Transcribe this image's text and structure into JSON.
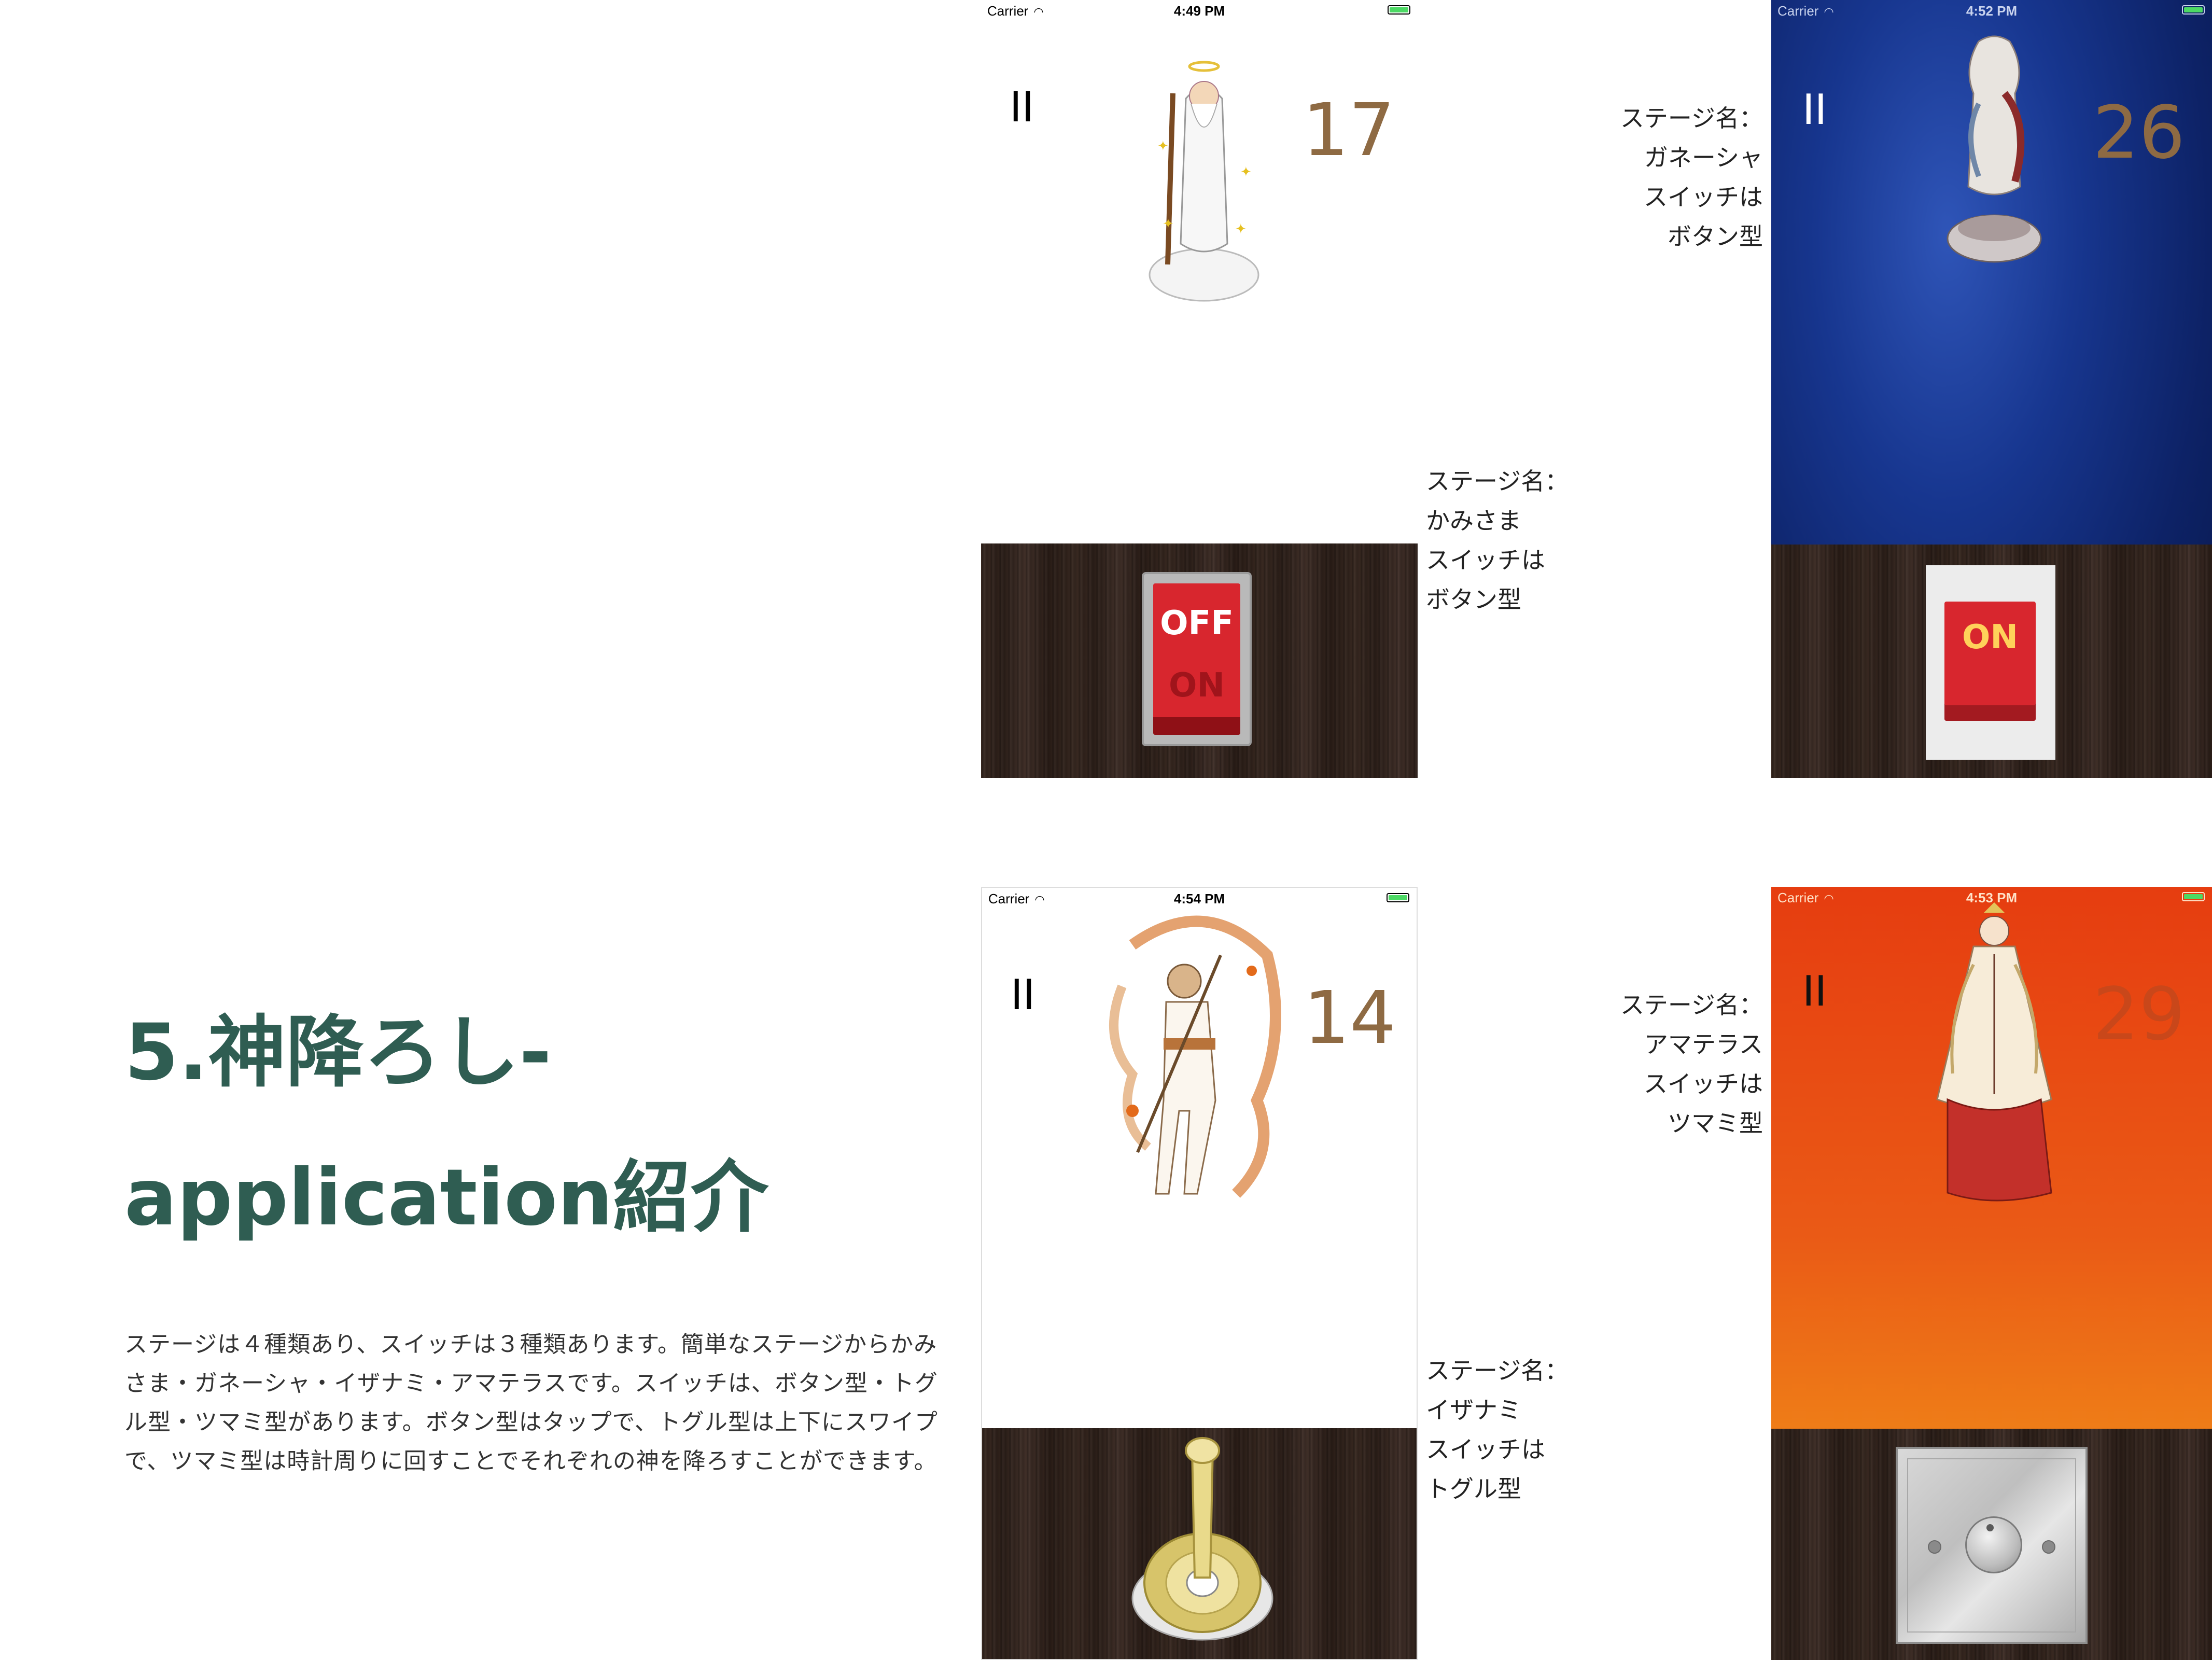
{
  "title": {
    "line1": "5.神降ろし-",
    "line2": "application紹介"
  },
  "description": "ステージは４種類あり、スイッチは３種類あります。簡単なステージからかみさま・ガネーシャ・イザナミ・アマテラスです。スイッチは、ボタン型・トグル型・ツマミ型があります。ボタン型はタップで、トグル型は上下にスワイプで、ツマミ型は時計周りに回すことでそれぞれの神を降ろすことができます。",
  "screens": {
    "kamisama": {
      "carrier": "Carrier",
      "time": "4:49 PM",
      "score": "17",
      "pause": "II",
      "switch_top": "OFF",
      "switch_bottom": "ON",
      "caption": [
        "ステージ名：",
        "かみさま",
        "スイッチは",
        "ボタン型"
      ]
    },
    "ganesha": {
      "carrier": "Carrier",
      "time": "4:52 PM",
      "score": "26",
      "pause": "II",
      "switch_label": "ON",
      "caption": [
        "ステージ名：",
        "ガネーシャ",
        "スイッチは",
        "ボタン型"
      ]
    },
    "izanami": {
      "carrier": "Carrier",
      "time": "4:54 PM",
      "score": "14",
      "pause": "II",
      "caption": [
        "ステージ名：",
        "イザナミ",
        "スイッチは",
        "トグル型"
      ]
    },
    "amaterasu": {
      "carrier": "Carrier",
      "time": "4:53 PM",
      "score": "29",
      "pause": "II",
      "caption": [
        "ステージ名：",
        "アマテラス",
        "スイッチは",
        "ツマミ型"
      ]
    }
  },
  "colors": {
    "title": "#2f5d52",
    "score": "#8e6a43",
    "space_bg": "#0f2a72",
    "sun_bg": "#e84a14",
    "switch_red": "#d8262e"
  },
  "icons": [
    "wifi-icon",
    "battery-icon",
    "pause-icon",
    "toggle-switch-icon",
    "dial-knob-icon"
  ]
}
